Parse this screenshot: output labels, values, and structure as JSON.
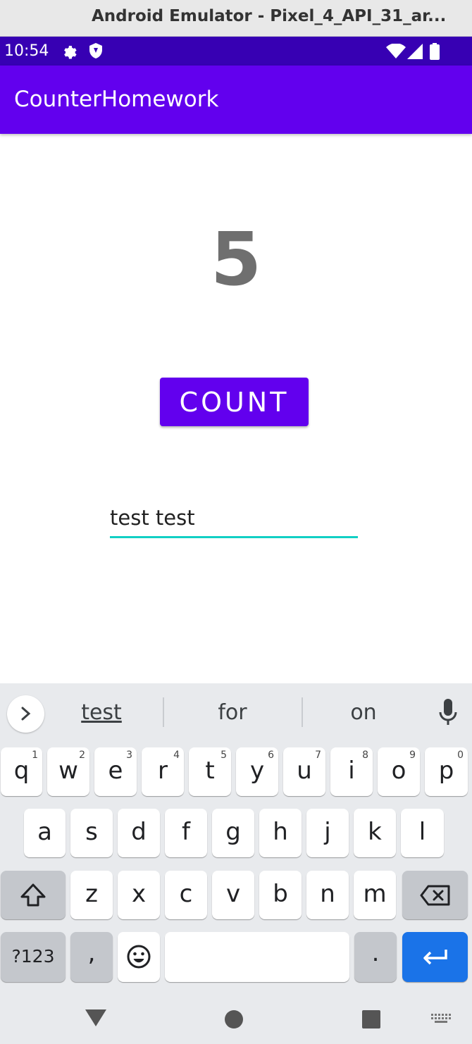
{
  "window": {
    "title": "Android Emulator - Pixel_4_API_31_ar..."
  },
  "status_bar": {
    "time": "10:54"
  },
  "app_bar": {
    "title": "CounterHomework"
  },
  "main": {
    "count_value": "5",
    "count_button_label": "COUNT",
    "text_field_value": "test test"
  },
  "keyboard": {
    "suggestions": [
      "test",
      "for",
      "on"
    ],
    "row1": [
      {
        "k": "q",
        "h": "1"
      },
      {
        "k": "w",
        "h": "2"
      },
      {
        "k": "e",
        "h": "3"
      },
      {
        "k": "r",
        "h": "4"
      },
      {
        "k": "t",
        "h": "5"
      },
      {
        "k": "y",
        "h": "6"
      },
      {
        "k": "u",
        "h": "7"
      },
      {
        "k": "i",
        "h": "8"
      },
      {
        "k": "o",
        "h": "9"
      },
      {
        "k": "p",
        "h": "0"
      }
    ],
    "row2": [
      "a",
      "s",
      "d",
      "f",
      "g",
      "h",
      "j",
      "k",
      "l"
    ],
    "row3": [
      "z",
      "x",
      "c",
      "v",
      "b",
      "n",
      "m"
    ],
    "symbols_label": "?123",
    "comma_label": ",",
    "period_label": "."
  },
  "colors": {
    "primary": "#6200ee",
    "status_bar": "#3700b3",
    "accent": "#11cfc4",
    "enter": "#1a73e8"
  },
  "icons": [
    "settings-icon",
    "shield-icon",
    "wifi-icon",
    "signal-icon",
    "battery-icon",
    "chevron-right-icon",
    "mic-icon",
    "shift-icon",
    "backspace-icon",
    "emoji-icon",
    "enter-icon",
    "nav-back-icon",
    "nav-home-icon",
    "nav-recents-icon",
    "keyboard-switch-icon"
  ]
}
